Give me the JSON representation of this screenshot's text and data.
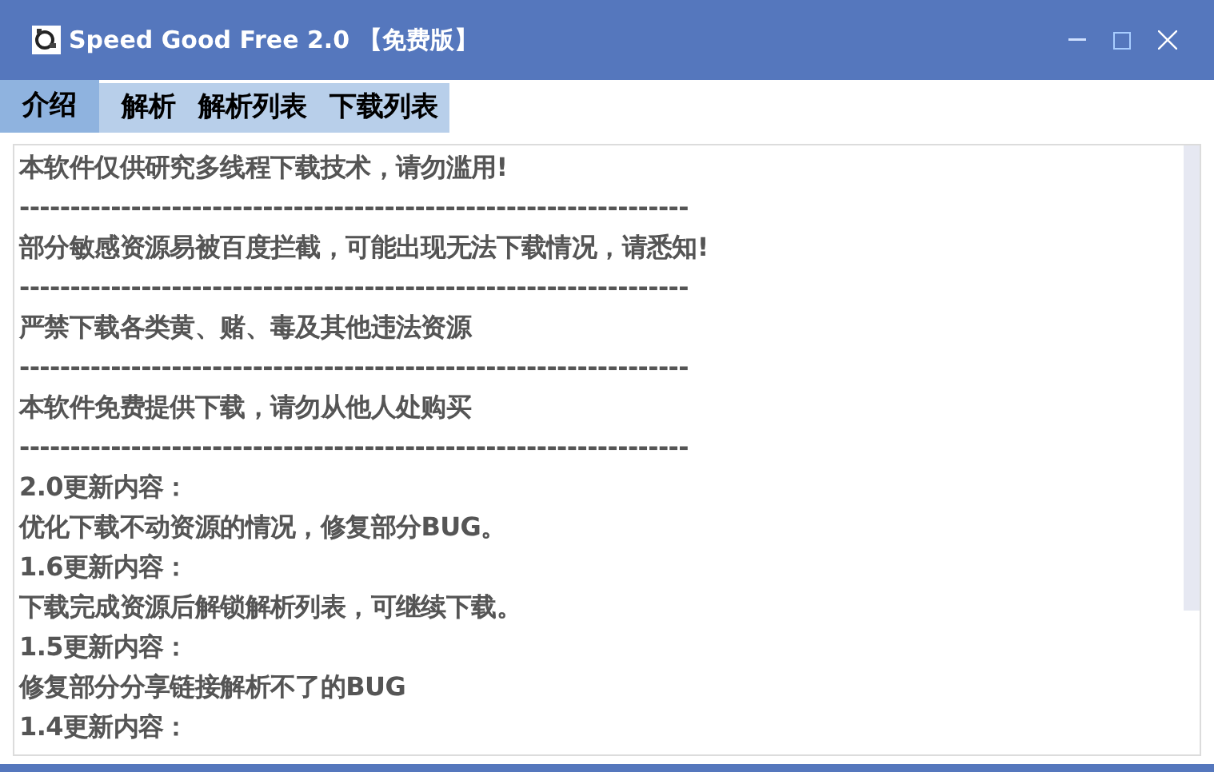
{
  "window": {
    "title": "Speed Good Free 2.0 【免费版】"
  },
  "tabs": [
    {
      "label": "介绍",
      "selected": true
    },
    {
      "label": "解析",
      "selected": false
    },
    {
      "label": "解析列表",
      "selected": false
    },
    {
      "label": "下载列表",
      "selected": false
    }
  ],
  "content": {
    "lines": [
      "本软件仅供研究多线程下载技术，请勿滥用!",
      "------------------------------------------------------------------",
      "部分敏感资源易被百度拦截，可能出现无法下载情况，请悉知!",
      "------------------------------------------------------------------",
      "严禁下载各类黄、赌、毒及其他违法资源",
      "------------------------------------------------------------------",
      "本软件免费提供下载，请勿从他人处购买",
      "------------------------------------------------------------------",
      "2.0更新内容：",
      "优化下载不动资源的情况，修复部分BUG。",
      "1.6更新内容：",
      "下载完成资源后解锁解析列表，可继续下载。",
      "1.5更新内容：",
      "修复部分分享链接解析不了的BUG",
      "1.4更新内容："
    ]
  }
}
